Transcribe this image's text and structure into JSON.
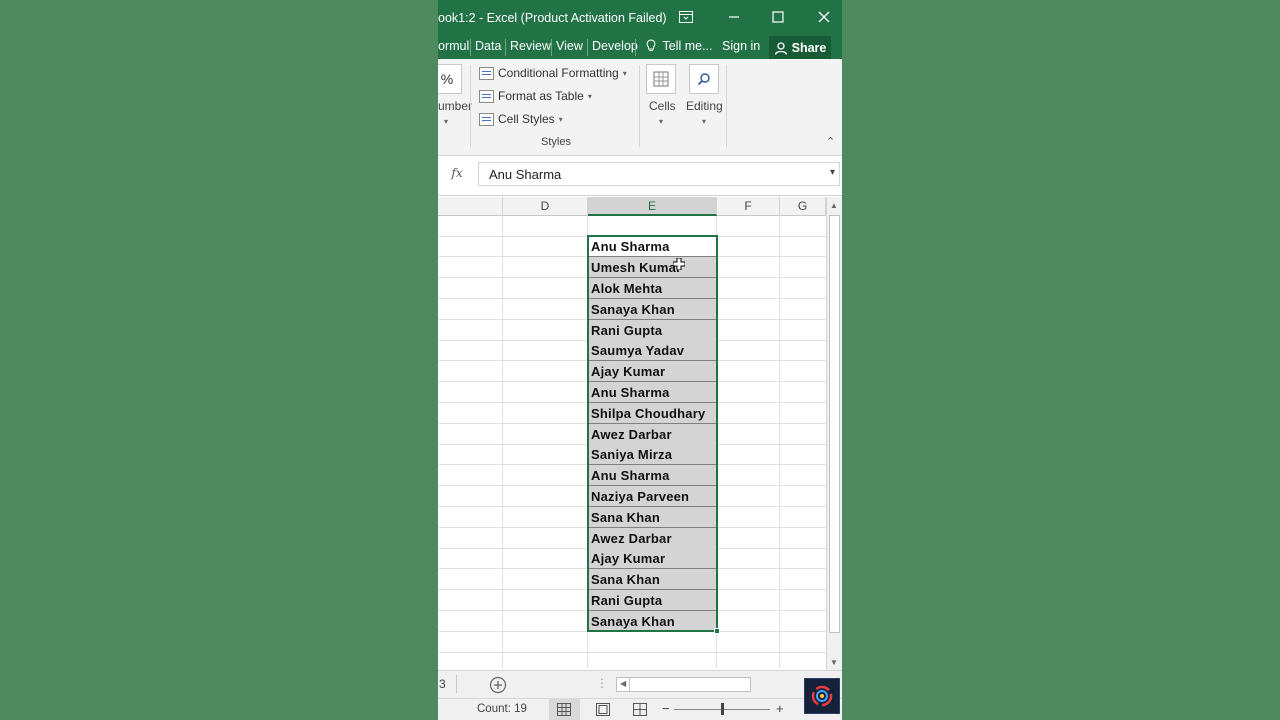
{
  "window": {
    "title": "ook1:2 - Excel (Product Activation Failed)"
  },
  "menu": {
    "tabs": [
      "ormul",
      "Data",
      "Review",
      "View",
      "Develop"
    ],
    "tell_me": "Tell me...",
    "sign_in": "Sign in",
    "share": "Share"
  },
  "ribbon": {
    "number_symbol": "%",
    "number_label": "umber",
    "conditional_formatting": "Conditional Formatting",
    "format_as_table": "Format as Table",
    "cell_styles": "Cell Styles",
    "styles_group": "Styles",
    "cells_label": "Cells",
    "editing_label": "Editing"
  },
  "formula_bar": {
    "fx": "fx",
    "value": "Anu Sharma"
  },
  "columns": {
    "d": "D",
    "e": "E",
    "f": "F",
    "g": "G"
  },
  "cells": [
    "Anu Sharma",
    "Umesh Kumar",
    "Alok Mehta",
    "Sanaya Khan",
    "Rani Gupta",
    "Saumya Yadav",
    "Ajay Kumar",
    "Anu Sharma",
    "Shilpa Choudhary",
    "Awez Darbar",
    "Saniya Mirza",
    "Anu Sharma",
    "Naziya Parveen",
    "Sana Khan",
    "Awez Darbar",
    "Ajay Kumar",
    "Sana Khan",
    "Rani Gupta",
    "Sanaya Khan"
  ],
  "sheet_bar": {
    "sheet_fragment": "3"
  },
  "status": {
    "count": "Count: 19"
  },
  "colors": {
    "excel_green": "#217346",
    "background": "#4e8a5e",
    "selection_fill": "#d4d4d4"
  }
}
